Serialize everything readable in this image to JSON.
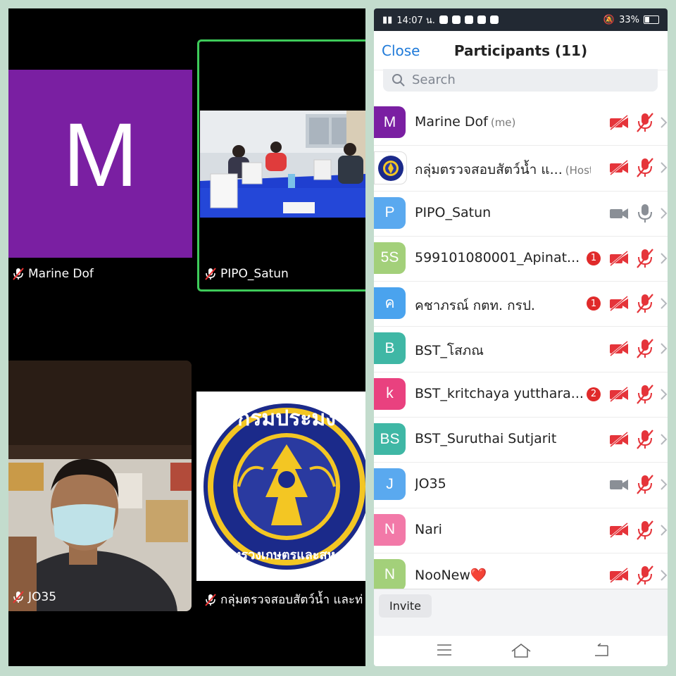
{
  "video_tiles": {
    "marine": {
      "letter": "M",
      "name": "Marine Dof",
      "bg": "#7a1fa2"
    },
    "pipo": {
      "name": "PIPO_Satun",
      "active_border": "#3ecb5a"
    },
    "jo35": {
      "name": "JO35"
    },
    "logo": {
      "name": "กลุ่มตรวจสอบสัตว์น้ำ และท่",
      "logo_top": "กรมประมง",
      "logo_bottom": "กระทรวงเกษตรและสหกรณ์"
    }
  },
  "status_bar": {
    "time": "14:07 น.",
    "battery": "33%"
  },
  "header": {
    "close": "Close",
    "title": "Participants (11)"
  },
  "search": {
    "placeholder": "Search"
  },
  "participants": [
    {
      "avatar": "M",
      "color": "#7a1fa2",
      "name": "Marine Dof",
      "tag": "(me)",
      "badge": "",
      "video": "off",
      "audio": "off"
    },
    {
      "avatar": "",
      "color": "#ffffff",
      "name": "กลุ่มตรวจสอบสัตว์น้ำ แ...",
      "tag": "(Host)",
      "badge": "",
      "video": "off",
      "audio": "off",
      "logo": true
    },
    {
      "avatar": "P",
      "color": "#5aa9ef",
      "name": "PIPO_Satun",
      "tag": "",
      "badge": "",
      "video": "on",
      "audio": "on"
    },
    {
      "avatar": "5S",
      "color": "#a3d07a",
      "name": "599101080001_Apinat...",
      "tag": "",
      "badge": "1",
      "video": "off",
      "audio": "off"
    },
    {
      "avatar": "ค",
      "color": "#4aa3ee",
      "name": "คชาภรณ์ กตท. กรป.",
      "tag": "",
      "badge": "1",
      "video": "off",
      "audio": "off"
    },
    {
      "avatar": "B",
      "color": "#3fb7a5",
      "name": "BST_โสภณ",
      "tag": "",
      "badge": "",
      "video": "off",
      "audio": "off"
    },
    {
      "avatar": "k",
      "color": "#e9417f",
      "name": "BST_kritchaya yutthara...",
      "tag": "",
      "badge": "2",
      "video": "off",
      "audio": "off"
    },
    {
      "avatar": "BS",
      "color": "#3fb7a5",
      "name": "BST_Suruthai Sutjarit",
      "tag": "",
      "badge": "",
      "video": "off",
      "audio": "off"
    },
    {
      "avatar": "J",
      "color": "#5aa9ef",
      "name": "JO35",
      "tag": "",
      "badge": "",
      "video": "on",
      "audio": "off"
    },
    {
      "avatar": "N",
      "color": "#f279a8",
      "name": "Nari",
      "tag": "",
      "badge": "",
      "video": "off",
      "audio": "off"
    },
    {
      "avatar": "N",
      "color": "#a3d07a",
      "name": "NooNew❤️",
      "tag": "",
      "badge": "",
      "video": "off",
      "audio": "off"
    }
  ],
  "footer": {
    "invite": "Invite"
  }
}
